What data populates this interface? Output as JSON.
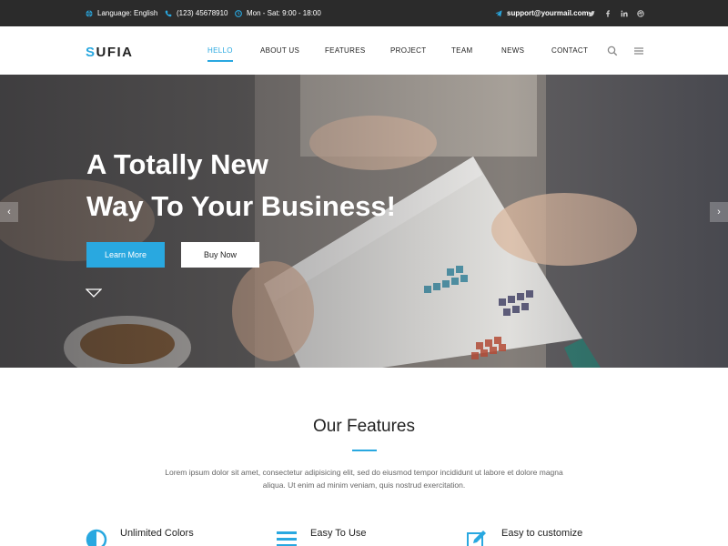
{
  "topbar": {
    "language": "Language: English",
    "phone": "(123) 45678910",
    "hours": "Mon - Sat: 9:00 - 18:00",
    "email": "support@yourmail.com",
    "social": [
      "twitter-icon",
      "facebook-icon",
      "linkedin-icon",
      "dribbble-icon"
    ],
    "icons": [
      "globe-icon",
      "phone-icon",
      "clock-icon",
      "send-icon"
    ]
  },
  "header": {
    "logo_first": "S",
    "logo_rest": "UFIA",
    "nav": [
      "HELLO",
      "ABOUT US",
      "FEATURES",
      "PROJECT",
      "TEAM",
      "NEWS",
      "CONTACT"
    ],
    "active_nav": "HELLO",
    "icons": [
      "search-icon",
      "menu-icon"
    ]
  },
  "hero": {
    "title_line1": "A Totally New",
    "title_line2": "Way To Your Business!",
    "primary_button": "Learn More",
    "secondary_button": "Buy Now",
    "prev_arrow": "‹",
    "next_arrow": "›"
  },
  "features": {
    "title": "Our Features",
    "description": "Lorem ipsum dolor sit amet, consectetur adipisicing elit, sed do eiusmod tempor incididunt ut labore et dolore magna aliqua. Ut enim ad minim veniam, quis nostrud exercitation.",
    "items": [
      {
        "title": "Unlimited Colors",
        "icon": "half-circle-icon"
      },
      {
        "title": "Easy To Use",
        "icon": "bars-icon"
      },
      {
        "title": "Easy to customize",
        "icon": "edit-icon"
      }
    ]
  },
  "colors": {
    "accent": "#29a8e0",
    "topbar": "#2b2b2b"
  }
}
